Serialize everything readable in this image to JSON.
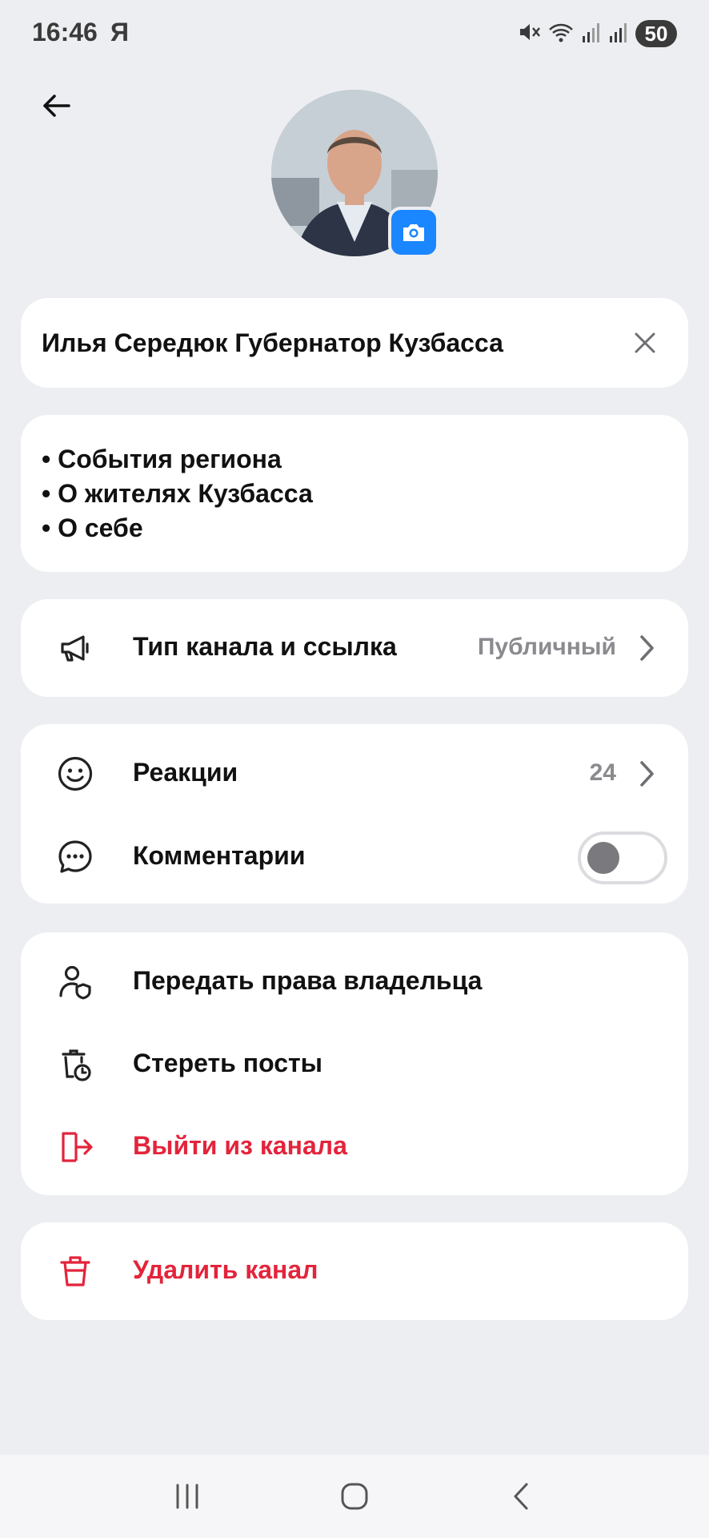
{
  "status_bar": {
    "time": "16:46",
    "carrier": "Я",
    "battery": "50",
    "icons": [
      "mute-icon",
      "wifi-icon",
      "signal-icon",
      "signal-icon"
    ]
  },
  "channel": {
    "name": "Илья Середюк Губернатор Кузбасса",
    "description_lines": [
      "• События региона",
      "• О жителях Кузбасса",
      "• О себе"
    ]
  },
  "settings": {
    "type": {
      "label": "Тип канала и ссылка",
      "value": "Публичный",
      "icon": "megaphone-icon"
    },
    "reactions": {
      "label": "Реакции",
      "value": "24",
      "icon": "smile-icon"
    },
    "comments": {
      "label": "Комментарии",
      "enabled": false,
      "icon": "chat-bubble-icon"
    }
  },
  "actions": {
    "transfer": {
      "label": "Передать права владельца",
      "icon": "user-shield-icon"
    },
    "clear_posts": {
      "label": "Стереть посты",
      "icon": "trash-clock-icon"
    },
    "leave": {
      "label": "Выйти из канала",
      "icon": "exit-icon"
    },
    "delete": {
      "label": "Удалить канал",
      "icon": "trash-icon"
    }
  },
  "colors": {
    "background": "#edeef2",
    "card": "#ffffff",
    "accent": "#1a86ff",
    "danger": "#e3243b",
    "secondary_text": "#8a8a8f"
  },
  "nav_bar": {
    "buttons": [
      "recent-apps-icon",
      "home-icon",
      "back-nav-icon"
    ]
  }
}
